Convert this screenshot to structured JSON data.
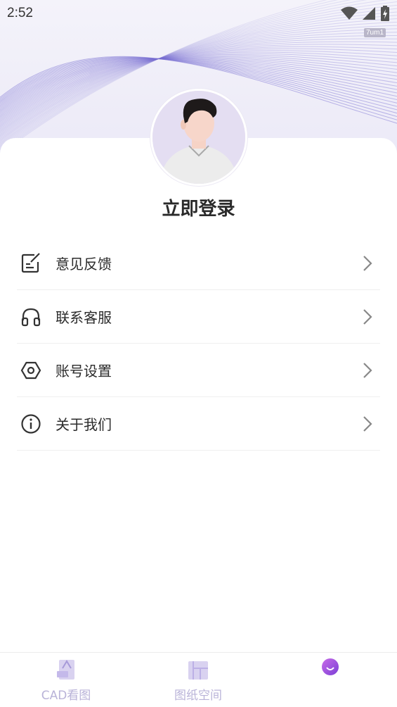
{
  "status_bar": {
    "time": "2:52",
    "badge": "7um1",
    "icons": [
      "wifi-icon",
      "signal-icon",
      "battery-icon"
    ]
  },
  "profile": {
    "login_label": "立即登录",
    "avatar": "avatar-icon"
  },
  "menu": {
    "items": [
      {
        "label": "意见反馈",
        "icon": "edit-icon"
      },
      {
        "label": "联系客服",
        "icon": "headset-icon"
      },
      {
        "label": "账号设置",
        "icon": "settings-hexagon-icon"
      },
      {
        "label": "关于我们",
        "icon": "info-icon"
      }
    ]
  },
  "tabbar": {
    "tabs": [
      {
        "label": "CAD看图",
        "icon": "cad-file-icon"
      },
      {
        "label": "图纸空间",
        "icon": "blueprint-icon"
      },
      {
        "label": "",
        "icon": "profile-smile-icon",
        "active": true
      }
    ]
  },
  "colors": {
    "accent": "#9b5de5",
    "tab_inactive": "#b9b3d8",
    "text": "#2b2b2b"
  }
}
